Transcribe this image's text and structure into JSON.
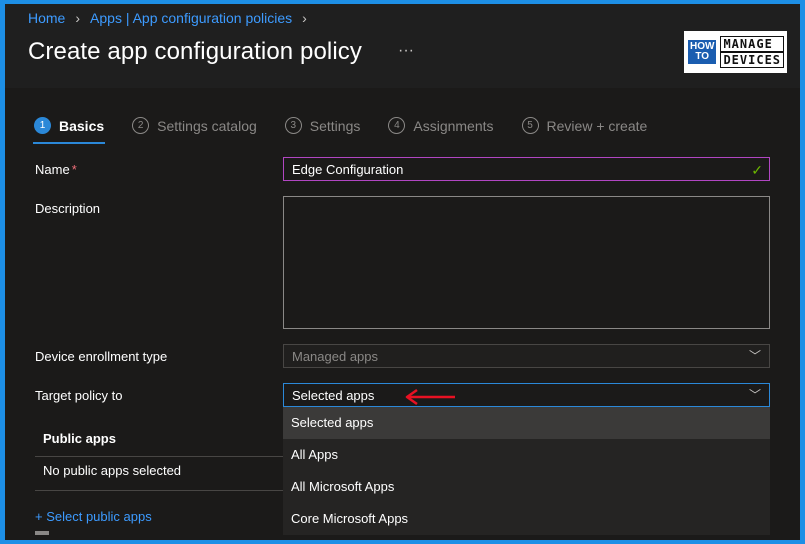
{
  "breadcrumb": [
    "Home",
    "Apps | App configuration policies"
  ],
  "page": {
    "title": "Create app configuration policy",
    "more_label": "···"
  },
  "logo": {
    "line1": "HOW",
    "line2": "TO",
    "word1": "MANAGE",
    "word2": "DEVICES"
  },
  "steps": [
    {
      "num": "1",
      "label": "Basics",
      "active": true
    },
    {
      "num": "2",
      "label": "Settings catalog"
    },
    {
      "num": "3",
      "label": "Settings"
    },
    {
      "num": "4",
      "label": "Assignments"
    },
    {
      "num": "5",
      "label": "Review + create"
    }
  ],
  "form": {
    "name_label": "Name",
    "required_marker": "*",
    "name_value": "Edge Configuration",
    "description_label": "Description",
    "enrollment_label": "Device enrollment type",
    "enrollment_value": "Managed apps",
    "target_label": "Target policy to",
    "target_value": "Selected apps"
  },
  "dropdown_options": [
    "Selected apps",
    "All Apps",
    "All Microsoft Apps",
    "Core Microsoft Apps"
  ],
  "public_apps": {
    "header": "Public apps",
    "empty": "No public apps selected",
    "link": "+ Select public apps"
  },
  "colors": {
    "accent": "#2b88d8",
    "link": "#3d9bff",
    "name_border": "#b146c2",
    "check": "#6bb700",
    "arrow": "#e81123",
    "frame": "#1d8fe6"
  }
}
